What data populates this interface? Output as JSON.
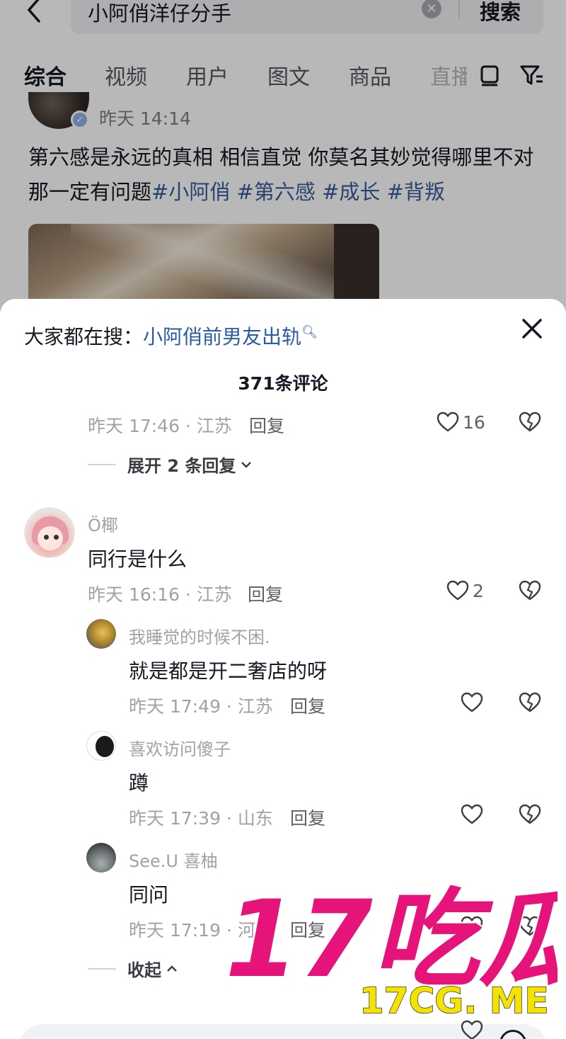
{
  "search": {
    "query": "小阿俏洋仔分手",
    "button_label": "搜索"
  },
  "tabs": [
    {
      "label": "综合"
    },
    {
      "label": "视频"
    },
    {
      "label": "用户"
    },
    {
      "label": "图文"
    },
    {
      "label": "商品"
    },
    {
      "label": "直播"
    }
  ],
  "post": {
    "time": "昨天 14:14",
    "text_plain": "第六感是永远的真相 相信直觉 你莫名其妙觉得哪里不对那一定有问题",
    "hashtags": [
      "#小阿俏",
      "#第六感",
      "#成长",
      "#背叛"
    ]
  },
  "sheet": {
    "hot_search_prefix": "大家都在搜：",
    "hot_search_link": "小阿俏前男友出轨",
    "comment_count": "371条评论",
    "top_comment": {
      "meta": "昨天 17:46 · 江苏",
      "reply_label": "回复",
      "likes": "16",
      "expand_label": "展开 2 条回复"
    },
    "comment": {
      "user": "Ö椰",
      "text": "同行是什么",
      "meta": "昨天 16:16 · 江苏",
      "reply_label": "回复",
      "likes": "2"
    },
    "replies": [
      {
        "user": "我睡觉的时候不困.",
        "text": "就是都是开二奢店的呀",
        "meta": "昨天 17:49 · 江苏",
        "reply_label": "回复"
      },
      {
        "user": "喜欢访问傻子",
        "text": "蹲",
        "meta": "昨天 17:39 · 山东",
        "reply_label": "回复"
      },
      {
        "user": "See.U 喜柚",
        "text": "同问",
        "meta": "昨天 17:19 · 河",
        "reply_label": "回复"
      }
    ],
    "collapse_label": "收起"
  },
  "watermark": {
    "big": "17吃瓜",
    "small": "17CG. ME"
  },
  "colors": {
    "link_blue": "#2a5ca6",
    "hashtag_blue": "#3a5d9a",
    "watermark_pink": "#e6147a",
    "watermark_yellow": "#f4e300"
  }
}
